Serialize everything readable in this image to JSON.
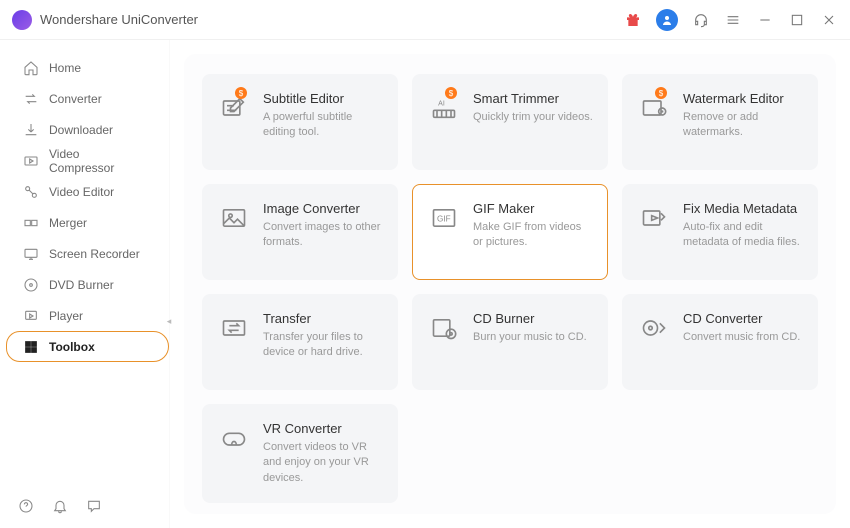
{
  "app": {
    "title": "Wondershare UniConverter"
  },
  "sidebar": {
    "items": [
      {
        "label": "Home"
      },
      {
        "label": "Converter"
      },
      {
        "label": "Downloader"
      },
      {
        "label": "Video Compressor"
      },
      {
        "label": "Video Editor"
      },
      {
        "label": "Merger"
      },
      {
        "label": "Screen Recorder"
      },
      {
        "label": "DVD Burner"
      },
      {
        "label": "Player"
      },
      {
        "label": "Toolbox"
      }
    ]
  },
  "badge_text": "$",
  "tools": [
    {
      "title": "Subtitle Editor",
      "desc": "A powerful subtitle editing tool.",
      "icon": "subtitle",
      "badge": true
    },
    {
      "title": "Smart Trimmer",
      "desc": "Quickly trim your videos.",
      "icon": "trimmer",
      "badge": true
    },
    {
      "title": "Watermark Editor",
      "desc": "Remove or add watermarks.",
      "icon": "watermark",
      "badge": true
    },
    {
      "title": "Image Converter",
      "desc": "Convert images to other formats.",
      "icon": "image"
    },
    {
      "title": "GIF Maker",
      "desc": "Make GIF from videos or pictures.",
      "icon": "gif",
      "highlight": true
    },
    {
      "title": "Fix Media Metadata",
      "desc": "Auto-fix and edit metadata of media files.",
      "icon": "metadata"
    },
    {
      "title": "Transfer",
      "desc": "Transfer your files to device or hard drive.",
      "icon": "transfer"
    },
    {
      "title": "CD Burner",
      "desc": "Burn your music to CD.",
      "icon": "cdburn"
    },
    {
      "title": "CD Converter",
      "desc": "Convert music from CD.",
      "icon": "cdconv"
    },
    {
      "title": "VR Converter",
      "desc": "Convert videos to VR and enjoy on your VR devices.",
      "icon": "vr"
    }
  ]
}
